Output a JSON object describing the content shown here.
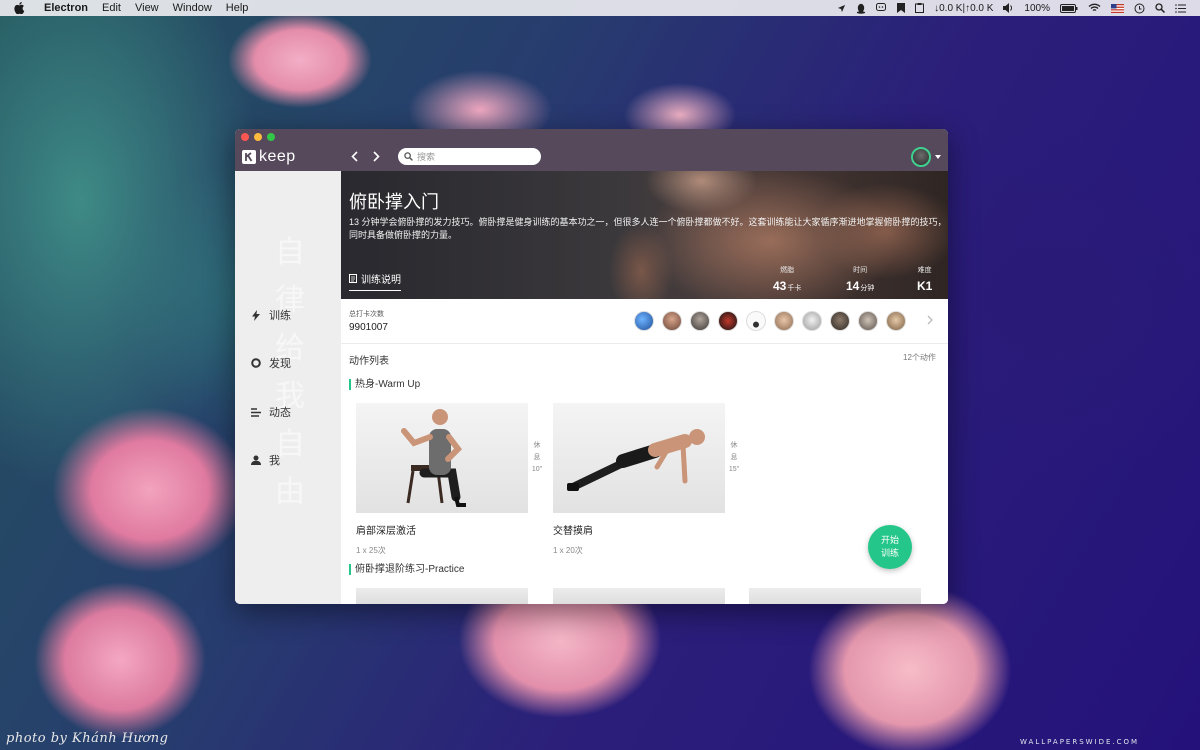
{
  "menubar": {
    "app_name": "Electron",
    "menus": [
      "Edit",
      "View",
      "Window",
      "Help"
    ],
    "network": "↓0.0 K|↑0.0 K",
    "battery": "100%"
  },
  "window": {
    "logo_text": "keep",
    "search_placeholder": "搜索"
  },
  "sidebar": {
    "watermark": "自律给我自由",
    "items": [
      {
        "label": "训练",
        "icon": "bolt-icon"
      },
      {
        "label": "发现",
        "icon": "circle-icon"
      },
      {
        "label": "动态",
        "icon": "feed-icon"
      },
      {
        "label": "我",
        "icon": "person-icon"
      }
    ]
  },
  "course": {
    "title": "俯卧撑入门",
    "description": "13 分钟学会俯卧撑的发力技巧。俯卧撑是健身训练的基本功之一，但很多人连一个俯卧撑都做不好。这套训练能让大家循序渐进地掌握俯卧撑的技巧，同时具备做俯卧撑的力量。",
    "tab_label": "训练说明",
    "stats": [
      {
        "label": "燃脂",
        "value": "43",
        "unit": "千卡"
      },
      {
        "label": "时间",
        "value": "14",
        "unit": "分钟"
      },
      {
        "label": "难度",
        "value": "K1",
        "unit": ""
      }
    ]
  },
  "checkin": {
    "label": "总打卡次数",
    "count": "9901007",
    "avatar_count": 10
  },
  "action_list": {
    "title": "动作列表",
    "count": "12个动作",
    "sections": [
      {
        "title": "热身-Warm Up",
        "cards": [
          {
            "name": "肩部深层激活",
            "reps": "1 x 25次",
            "rest_label": "休息",
            "rest_time": "10\""
          },
          {
            "name": "交替摸肩",
            "reps": "1 x 20次",
            "rest_label": "休息",
            "rest_time": "15\""
          }
        ]
      },
      {
        "title": "俯卧撑退阶练习-Practice",
        "cards": []
      }
    ]
  },
  "start_button": {
    "line1": "开始",
    "line2": "训练"
  },
  "wallpaper": {
    "credit": "photo by Khánh Hương",
    "site": "WALLPAPERSWIDE.COM"
  },
  "colors": {
    "accent": "#24c789",
    "titlebar": "#55495b"
  }
}
